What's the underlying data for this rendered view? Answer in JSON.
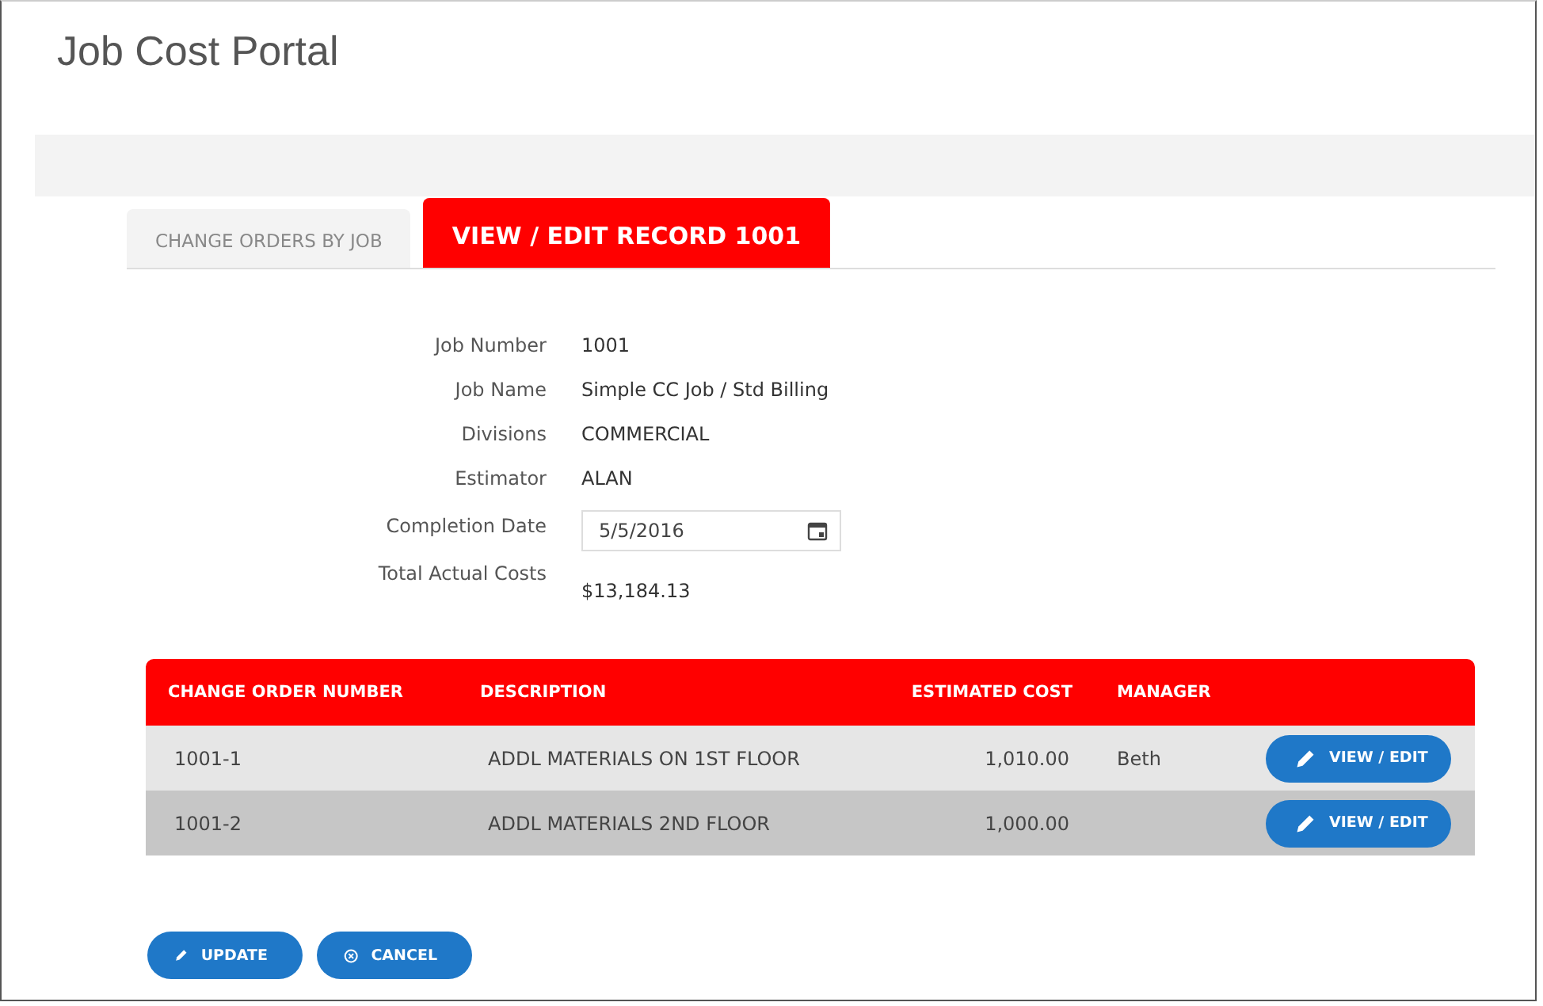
{
  "page": {
    "title": "Job Cost Portal"
  },
  "tabs": [
    {
      "label": "CHANGE ORDERS BY JOB",
      "selected": false
    },
    {
      "label": "VIEW / EDIT RECORD 1001",
      "selected": true
    }
  ],
  "fields": [
    {
      "kind": "text",
      "label": "Job Number",
      "value": "1001"
    },
    {
      "kind": "text",
      "label": "Job Name",
      "value": "Simple CC Job / Std Billing"
    },
    {
      "kind": "text",
      "label": "Divisions",
      "value": "COMMERCIAL"
    },
    {
      "kind": "text",
      "label": "Estimator",
      "value": "ALAN"
    },
    {
      "kind": "date",
      "label": "Completion Date",
      "value": "5/5/2016"
    },
    {
      "kind": "text",
      "label": "Total Actual Costs",
      "value": "$13,184.13"
    }
  ],
  "table": {
    "columns": [
      "CHANGE ORDER NUMBER",
      "DESCRIPTION",
      "ESTIMATED COST",
      "MANAGER"
    ],
    "rows": [
      {
        "number": "1001-1",
        "description": "ADDL MATERIALS ON 1ST FLOOR",
        "estimated_cost": "1,010.00",
        "manager": "Beth",
        "action": "VIEW / EDIT"
      },
      {
        "number": "1001-2",
        "description": "ADDL MATERIALS 2ND FLOOR",
        "estimated_cost": "1,000.00",
        "manager": "",
        "action": "VIEW / EDIT"
      }
    ]
  },
  "buttons": [
    {
      "kind": "update",
      "label": "UPDATE"
    },
    {
      "kind": "cancel",
      "label": "CANCEL"
    }
  ]
}
